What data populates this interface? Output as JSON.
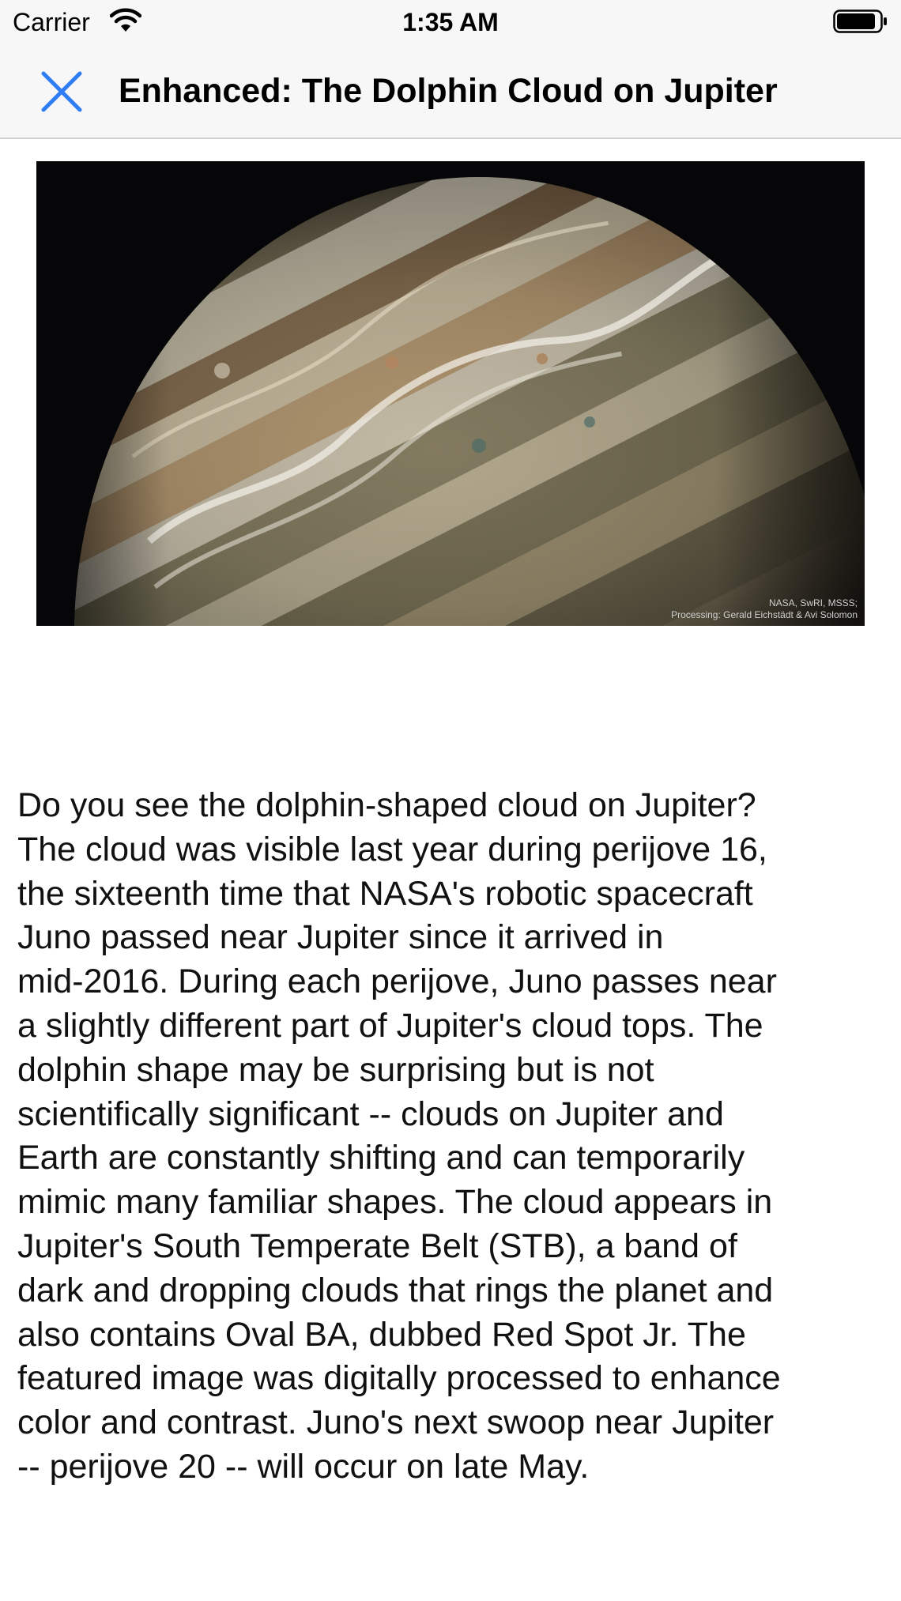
{
  "status_bar": {
    "carrier": "Carrier",
    "time": "1:35 AM",
    "icons": [
      "wifi-icon",
      "battery-icon"
    ]
  },
  "nav": {
    "title": "Enhanced: The Dolphin Cloud on Jupiter",
    "close_icon": "close-icon",
    "accent_color": "#2f7cf6"
  },
  "image": {
    "credit_line1": "NASA, SwRI, MSSS;",
    "credit_line2": "Processing: Gerald Eichstädt & Avi Solomon"
  },
  "article": {
    "text": "Do you see the dolphin-shaped cloud on Jupiter?\nThe cloud was visible last year during perijove 16,\nthe sixteenth time that NASA's robotic spacecraft\nJuno passed near Jupiter since it arrived in\nmid-2016.  During each perijove, Juno passes near\na slightly different part of Jupiter's cloud tops.  The\ndolphin shape may be surprising but is not\nscientifically significant -- clouds on Jupiter and\nEarth are constantly shifting and can temporarily\nmimic many familiar shapes. The cloud appears in\nJupiter's South Temperate Belt (STB), a band of\ndark and dropping clouds that rings the planet and\nalso contains Oval BA, dubbed Red Spot Jr.  The\nfeatured image was digitally processed to enhance\ncolor and contrast.  Juno's next swoop near Jupiter\n-- perijove 20 -- will occur on late May."
  }
}
